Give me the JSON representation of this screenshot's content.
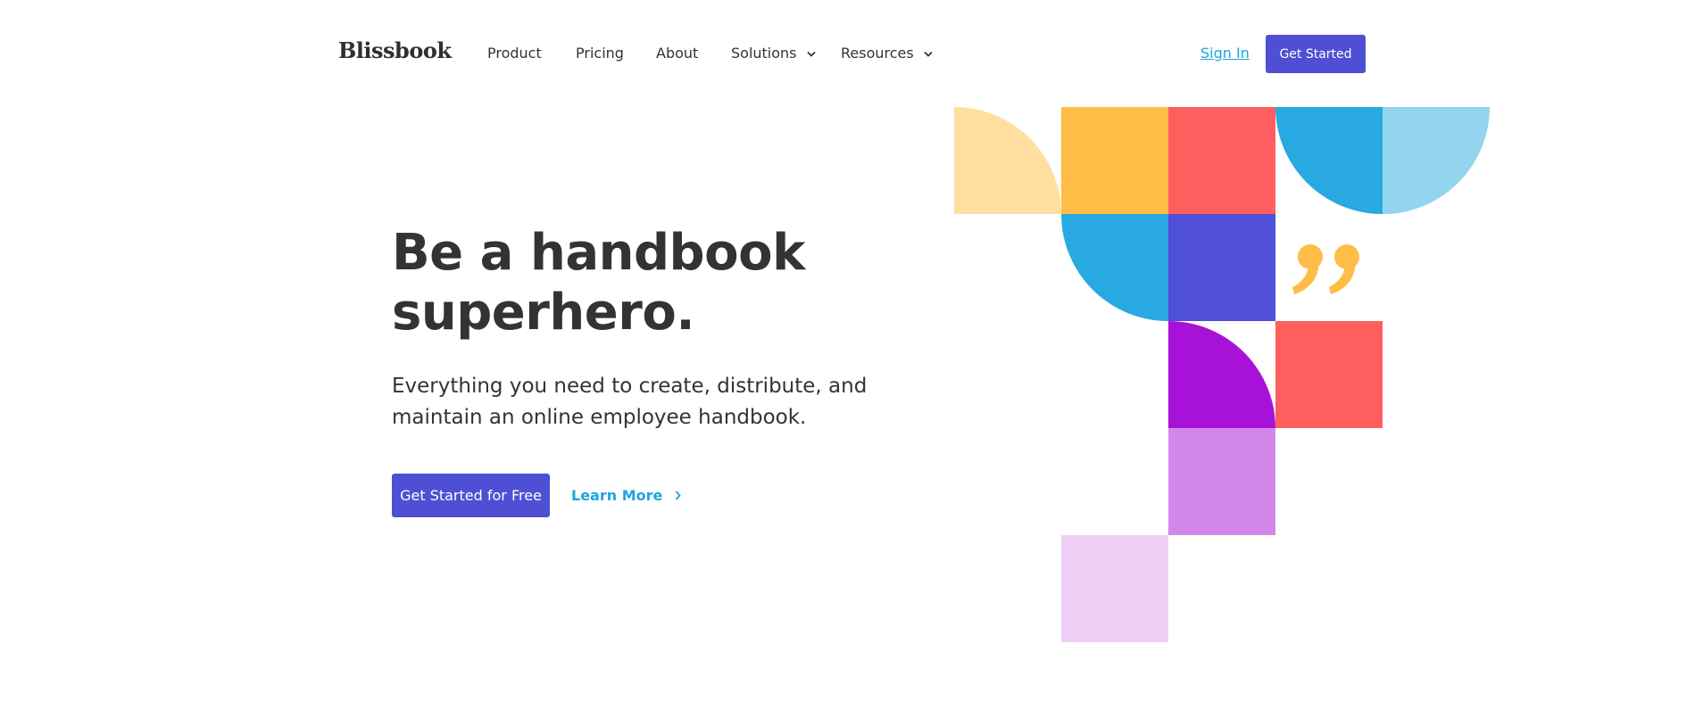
{
  "header": {
    "logo": "Blissbook",
    "nav": [
      {
        "label": "Product",
        "dropdown": false
      },
      {
        "label": "Pricing",
        "dropdown": false
      },
      {
        "label": "About",
        "dropdown": false
      },
      {
        "label": "Solutions",
        "dropdown": true
      },
      {
        "label": "Resources",
        "dropdown": true
      }
    ],
    "sign_in": "Sign In",
    "get_started": "Get Started"
  },
  "hero": {
    "title_line1": "Be a handbook",
    "title_line2": "superhero.",
    "subtitle_line1": "Everything you need to create, distribute, and",
    "subtitle_line2": "maintain an online employee handbook.",
    "cta_primary": "Get Started for Free",
    "cta_secondary": "Learn More"
  },
  "icons": {
    "nav_dropdown": "chevron-down-icon",
    "learn_more": "chevron-right-icon",
    "quote": "closing-quote-icon"
  },
  "colors": {
    "brand_purple": "#4f4fd6",
    "link_blue": "#1fa4e0",
    "yellow": "#ffbd48",
    "light_yellow": "#ffdf9f",
    "red": "#ff5e5e",
    "blue": "#29a9e1",
    "light_blue": "#93d4ef",
    "indigo": "#4f4fd8",
    "violet": "#a812d8",
    "lilac": "#d487ea",
    "pale_lilac": "#edcff6"
  }
}
